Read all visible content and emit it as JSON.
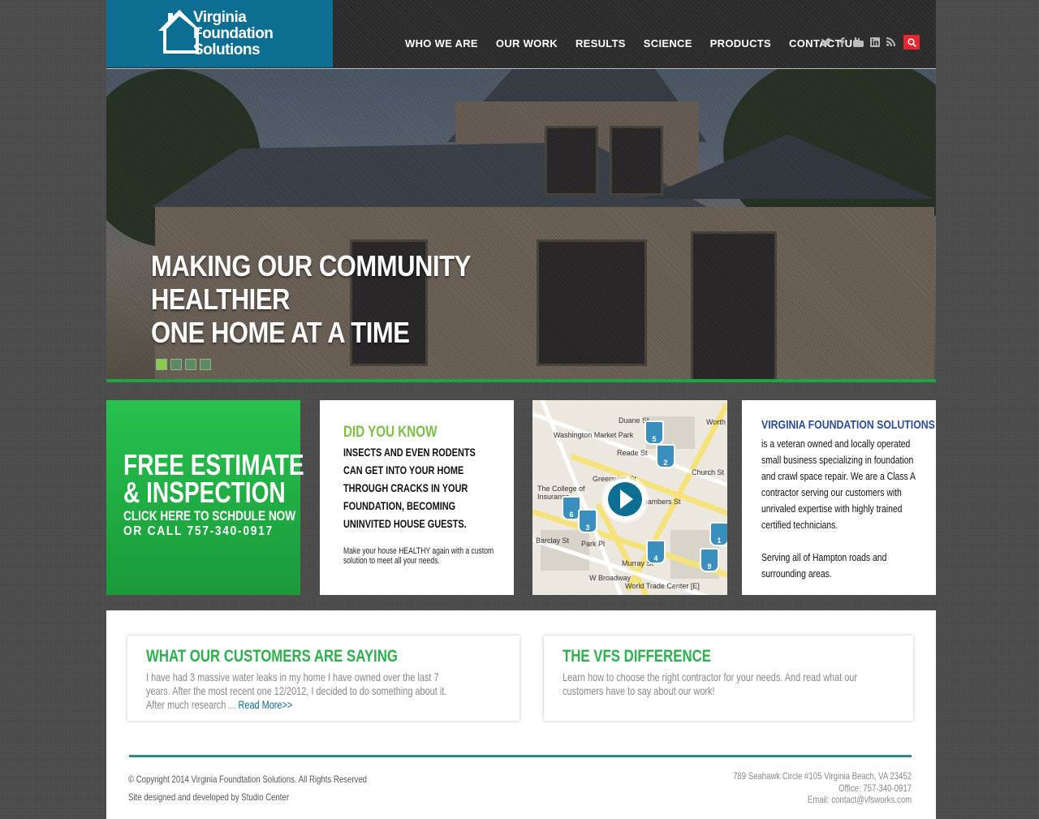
{
  "logo": {
    "line1": "Virginia",
    "line2": "Foundation",
    "line3": "Solutions"
  },
  "nav": [
    "WHO WE ARE",
    "OUR WORK",
    "RESULTS",
    "SCIENCE",
    "PRODUCTS",
    "CONTACT US"
  ],
  "social_icons": [
    "twitter-icon",
    "facebook-icon",
    "youtube-icon",
    "linkedin-icon",
    "rss-icon"
  ],
  "search_icon": "search-icon",
  "hero": {
    "line1": "MAKING OUR COMMUNITY",
    "line2": "HEALTHIER",
    "line3": "ONE HOME AT A TIME",
    "slide_count": 4,
    "active_slide": 1
  },
  "estimate": {
    "line1": "FREE ESTIMATE",
    "line2": "& INSPECTION",
    "line3": "CLICK HERE TO SCHDULE NOW",
    "line4": "OR CALL 757-340-0917"
  },
  "did_you_know": {
    "title": "DID YOU KNOW",
    "body": "INSECTS AND EVEN RODENTS CAN GET INTO YOUR HOME THROUGH CRACKS IN YOUR FOUNDATION, BECOMING UNINVITED HOUSE GUESTS.",
    "small": "Make your house HEALTHY again with a custom solution to meet all your needs."
  },
  "map": {
    "labels": [
      "Washington Market Park",
      "Duane St",
      "Reade St",
      "Chambers St",
      "The College of Insurance",
      "Barclay St",
      "Park Pl",
      "Murray St",
      "W Broadway",
      "World Trade Center [E]",
      "Church St",
      "Worth St",
      "Greenwich St"
    ],
    "pins": [
      "5",
      "2",
      "6",
      "3",
      "4",
      "9",
      "1"
    ]
  },
  "about": {
    "title": "VIRGINIA FOUNDATION SOLUTIONS",
    "body": "is a veteran owned and locally operated small business specializing in foundation and crawl space repair. We are a Class A contractor serving our customers with unrivaled expertise with highly trained certified technicians.",
    "body2": "Serving all of Hampton roads and surrounding areas."
  },
  "customers": {
    "title": "WHAT OUR CUSTOMERS ARE SAYING",
    "body": "I have had 3 massive water leaks in my home I have owned over the last 7 years. After the most recent one 12/2012, I decided to do something about it. After much research ...",
    "read_more": "Read More>>"
  },
  "difference": {
    "title": "THE VFS DIFFERENCE",
    "body": "Learn how to choose the right contractor for your needs. And read what our customers have to say about our work!"
  },
  "footer": {
    "copyright": "© Copyright 2014 Virginia Foundtation Solutions. All Rights Reserved",
    "credit": "Site designed and developed by Studio Center",
    "address": "789 Seahawk Circle #105  Virginia Beach, VA 23452",
    "office": "Office: 757-340-0917",
    "email": "Email: contact@vfsworks.com"
  },
  "colors": {
    "brand_blue": "#0d6e93",
    "green": "#1ea641",
    "accent_green": "#7bc043",
    "search_red": "#e8262e",
    "about_blue": "#2d4b9a"
  }
}
